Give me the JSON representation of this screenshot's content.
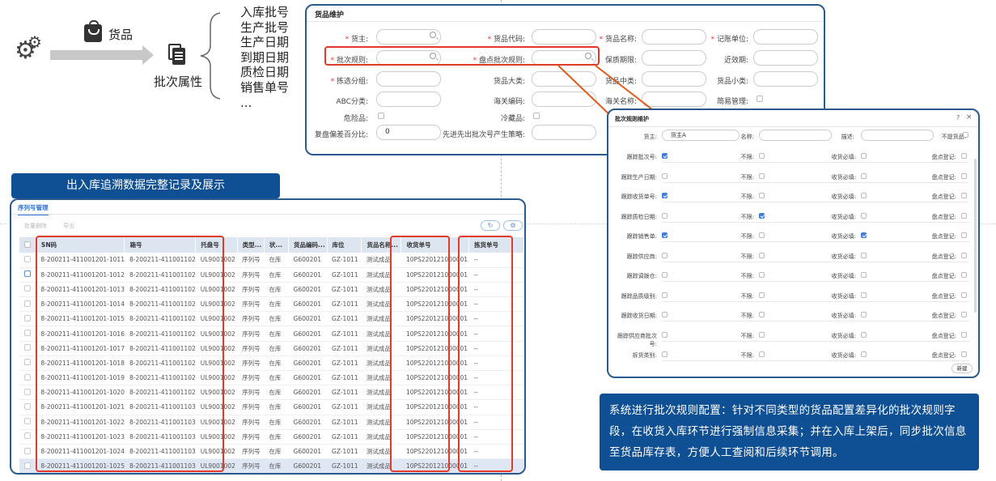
{
  "diagram": {
    "bag_label": "货品",
    "batch_label": "批次属性",
    "attributes": [
      "入库批号",
      "生产批号",
      "生产日期",
      "到期日期",
      "质检日期",
      "销售单号",
      "..."
    ]
  },
  "goods_panel": {
    "title": "货品维护",
    "labels": {
      "owner": "货主:",
      "goods_code": "货品代码:",
      "goods_name": "货品名称:",
      "unit": "记账单位:",
      "batch_rule": "批次规则:",
      "count_rule": "盘点批次规则:",
      "shelf_life": "保质期限:",
      "near_expiry": "近效期:",
      "pick_group": "拣选分组:",
      "category_l": "货品大类:",
      "category_m": "货品中类:",
      "category_s": "货品小类:",
      "abc": "ABC分类:",
      "customs_code": "海关编码:",
      "customs_name": "海关名称:",
      "simple_mgmt": "简易管理:",
      "hazard": "危险品:",
      "cold": "冷藏品:",
      "recheck_pct": "复盘偏差百分比:",
      "fifo": "先进先出批次号产生策略:"
    },
    "recheck_value": "0"
  },
  "title_banner": "出入库追溯数据完整记录及展示",
  "sn_panel": {
    "tab": "序列号管理",
    "toolbar": [
      "批量删除",
      "导出"
    ],
    "columns": [
      "SN码",
      "箱号",
      "托盘号",
      "类型...",
      "状...",
      "货品编码...",
      "库位",
      "货品名称...",
      "收货单号",
      "拣货单号"
    ],
    "rows": [
      [
        "8-200211-411001201-1011",
        "8-200211-411001102",
        "UL9001002",
        "序列号",
        "在库",
        "G600201",
        "GZ-1011",
        "测试成品",
        "10PS220121000001",
        "--"
      ],
      [
        "8-200211-411001201-1012",
        "8-200211-411001102",
        "UL9001002",
        "序列号",
        "在库",
        "G600201",
        "GZ-1011",
        "测试成品",
        "10PS220121000001",
        "--"
      ],
      [
        "8-200211-411001201-1013",
        "8-200211-411001102",
        "UL9001002",
        "序列号",
        "在库",
        "G600201",
        "GZ-1011",
        "测试成品",
        "10PS220121000001",
        "--"
      ],
      [
        "8-200211-411001201-1014",
        "8-200211-411001102",
        "UL9001002",
        "序列号",
        "在库",
        "G600201",
        "GZ-1011",
        "测试成品",
        "10PS220121000001",
        "--"
      ],
      [
        "8-200211-411001201-1015",
        "8-200211-411001102",
        "UL9001002",
        "序列号",
        "在库",
        "G600201",
        "GZ-1011",
        "测试成品",
        "10PS220121000001",
        "--"
      ],
      [
        "8-200211-411001201-1016",
        "8-200211-411001102",
        "UL9001002",
        "序列号",
        "在库",
        "G600201",
        "GZ-1011",
        "测试成品",
        "10PS220121000001",
        "--"
      ],
      [
        "8-200211-411001201-1017",
        "8-200211-411001102",
        "UL9001002",
        "序列号",
        "在库",
        "G600201",
        "GZ-1011",
        "测试成品",
        "10PS220121000001",
        "--"
      ],
      [
        "8-200211-411001201-1018",
        "8-200211-411001102",
        "UL9001002",
        "序列号",
        "在库",
        "G600201",
        "GZ-1011",
        "测试成品",
        "10PS220121000001",
        "--"
      ],
      [
        "8-200211-411001201-1019",
        "8-200211-411001102",
        "UL9001002",
        "序列号",
        "在库",
        "G600201",
        "GZ-1011",
        "测试成品",
        "10PS220121000001",
        "--"
      ],
      [
        "8-200211-411001201-1020",
        "8-200211-411001102",
        "UL9001002",
        "序列号",
        "在库",
        "G600201",
        "GZ-1011",
        "测试成品",
        "10PS220121000001",
        "--"
      ],
      [
        "8-200211-411001201-1021",
        "8-200211-411001103",
        "UL9001002",
        "序列号",
        "在库",
        "G600201",
        "GZ-1011",
        "测试成品",
        "10PS220121000001",
        "--"
      ],
      [
        "8-200211-411001201-1022",
        "8-200211-411001103",
        "UL9001002",
        "序列号",
        "在库",
        "G600201",
        "GZ-1011",
        "测试成品",
        "10PS220121000001",
        "--"
      ],
      [
        "8-200211-411001201-1023",
        "8-200211-411001103",
        "UL9001002",
        "序列号",
        "在库",
        "G600201",
        "GZ-1011",
        "测试成品",
        "10PS220121000001",
        "--"
      ],
      [
        "8-200211-411001201-1024",
        "8-200211-411001103",
        "UL9001002",
        "序列号",
        "在库",
        "G600201",
        "GZ-1011",
        "测试成品",
        "10PS220121000001",
        "--"
      ],
      [
        "8-200211-411001201-1025",
        "8-200211-411001103",
        "UL9001002",
        "序列号",
        "在库",
        "G600201",
        "GZ-1011",
        "测试成品",
        "10PS220121000001",
        "--"
      ]
    ]
  },
  "rule_dialog": {
    "title": "批次规则维护",
    "top": {
      "owner_label": "货主:",
      "owner_value": "货主A",
      "name_label": "名称:",
      "desc_label": "描述:",
      "disabled_label": "不提货品:"
    },
    "rows": [
      {
        "label": "跟踪批次号:",
        "checked": true,
        "c2": false,
        "c3": false
      },
      {
        "label": "跟踪生产日期:",
        "checked": false,
        "c2": false,
        "c3": false
      },
      {
        "label": "跟踪收货单号:",
        "checked": true,
        "c2": false,
        "c3": false
      },
      {
        "label": "跟踪质检日期:",
        "checked": false,
        "c2": true,
        "c3": false
      },
      {
        "label": "跟踪销售单:",
        "checked": true,
        "c2": false,
        "c3": true
      },
      {
        "label": "跟踪供应商:",
        "checked": false,
        "c2": false,
        "c3": false
      },
      {
        "label": "跟踪调拨仓:",
        "checked": false,
        "c2": false,
        "c3": false
      },
      {
        "label": "跟踪品质级别:",
        "checked": false,
        "c2": false,
        "c3": false
      },
      {
        "label": "跟踪收货日期:",
        "checked": false,
        "c2": false,
        "c3": false
      },
      {
        "label": "跟踪供应商批次号:",
        "checked": false,
        "c2": false,
        "c3": false
      },
      {
        "label": "拆货类别:",
        "checked": false,
        "c2": false,
        "c3": false
      }
    ],
    "col2_label": "不限:",
    "col3_label": "收货必填:",
    "col4_label": "盘点登记:",
    "new_button": "新建"
  },
  "description": "系统进行批次规则配置：针对不同类型的货品配置差异化的批次规则字段，在收货入库环节进行强制信息采集；并在入库上架后，同步批次信息至货品库存表，方便人工查阅和后续环节调用。"
}
